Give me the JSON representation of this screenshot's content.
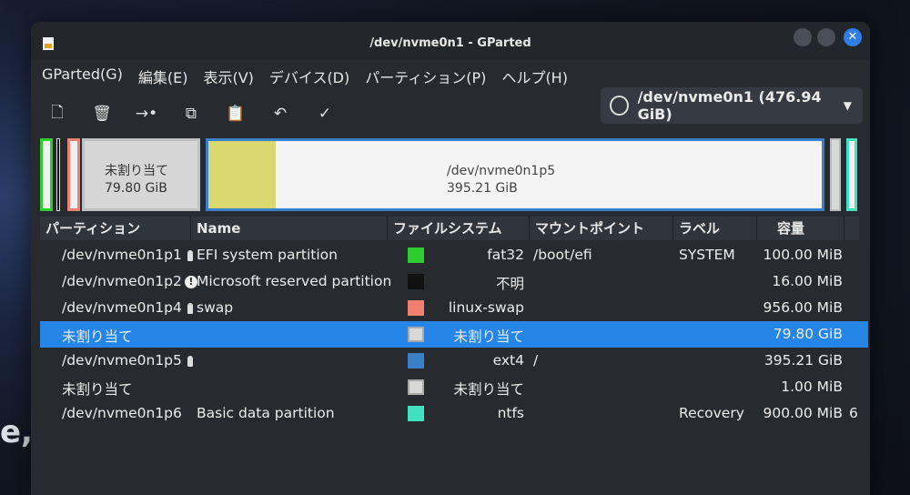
{
  "window": {
    "title": "/dev/nvme0n1 - GParted"
  },
  "menu": [
    "GParted(G)",
    "編集(E)",
    "表示(V)",
    "デバイス(D)",
    "パーティション(P)",
    "ヘルプ(H)"
  ],
  "device_selector": {
    "label": "/dev/nvme0n1 (476.94 GiB)"
  },
  "map": {
    "unalloc_label": "未割り当て",
    "unalloc_size": "79.80 GiB",
    "p5_label": "/dev/nvme0n1p5",
    "p5_size": "395.21 GiB",
    "p5_used_fraction": 0.11
  },
  "columns": [
    "パーティション",
    "Name",
    "ファイルシステム",
    "マウントポイント",
    "ラベル",
    "容量"
  ],
  "rows": [
    {
      "partition": "/dev/nvme0n1p1",
      "name": "EFI system partition",
      "fs": "fat32",
      "fs_color": "#2ecc2e",
      "mount": "/boot/efi",
      "label": "SYSTEM",
      "size": "100.00 MiB"
    },
    {
      "partition": "/dev/nvme0n1p2",
      "name": "Microsoft reserved partition",
      "fs": "不明",
      "fs_color": "#111111",
      "mount": "",
      "label": "",
      "size": "16.00 MiB"
    },
    {
      "partition": "/dev/nvme0n1p4",
      "name": "swap",
      "fs": "linux-swap",
      "fs_color": "#f08070",
      "mount": "",
      "label": "",
      "size": "956.00 MiB"
    },
    {
      "partition": "未割り当て",
      "name": "",
      "fs": "未割り当て",
      "fs_color": "#d8d8d8",
      "mount": "",
      "label": "",
      "size": "79.80 GiB"
    },
    {
      "partition": "/dev/nvme0n1p5",
      "name": "",
      "fs": "ext4",
      "fs_color": "#3a80c8",
      "mount": "/",
      "label": "",
      "size": "395.21 GiB"
    },
    {
      "partition": "未割り当て",
      "name": "",
      "fs": "未割り当て",
      "fs_color": "#d8d8d8",
      "mount": "",
      "label": "",
      "size": "1.00 MiB"
    },
    {
      "partition": "/dev/nvme0n1p6",
      "name": "Basic data partition",
      "fs": "ntfs",
      "fs_color": "#40e0c0",
      "mount": "",
      "label": "Recovery",
      "size": "900.00 MiB",
      "extra": "6"
    }
  ],
  "background_text": "e,"
}
